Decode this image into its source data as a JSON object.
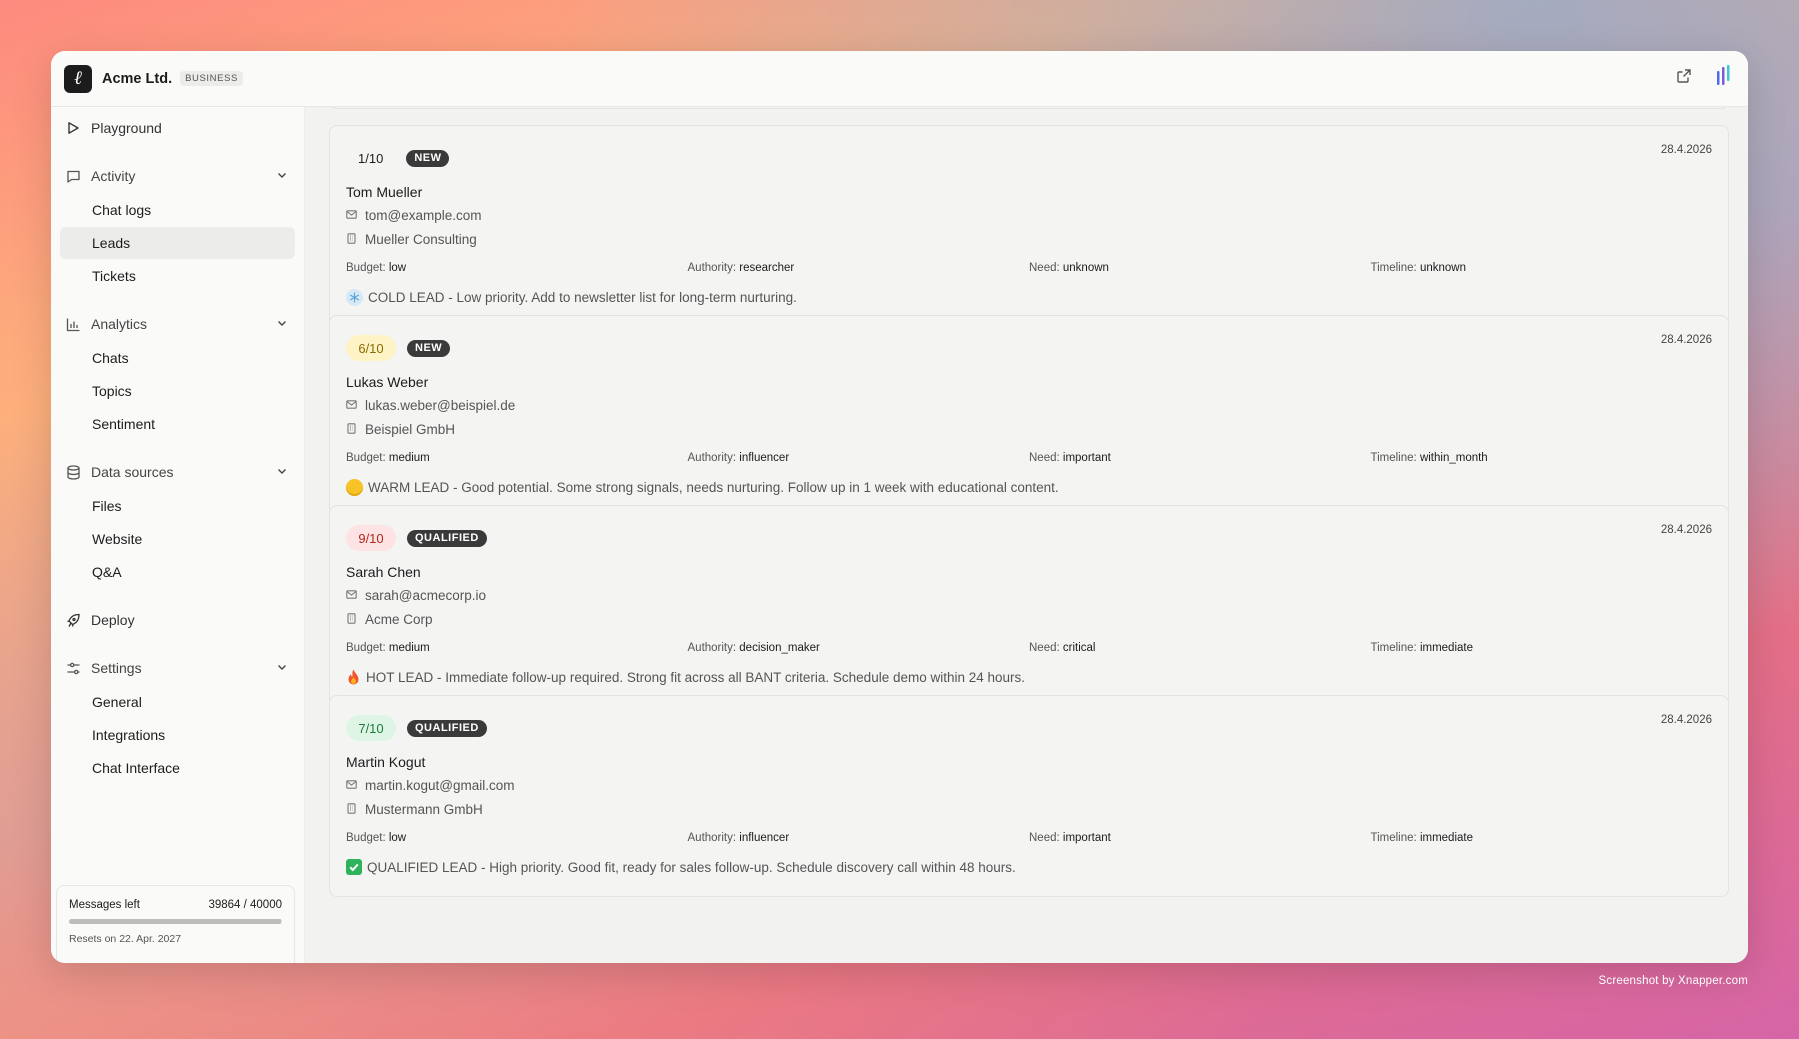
{
  "org": {
    "name": "Acme Ltd.",
    "plan": "BUSINESS",
    "logo_letter": "ℓ"
  },
  "sidebar": {
    "playground": "Playground",
    "groups": [
      {
        "label": "Activity",
        "icon": "chat-bubble-icon",
        "items": [
          "Chat logs",
          "Leads",
          "Tickets"
        ]
      },
      {
        "label": "Analytics",
        "icon": "bar-chart-icon",
        "items": [
          "Chats",
          "Topics",
          "Sentiment"
        ]
      },
      {
        "label": "Data sources",
        "icon": "database-icon",
        "items": [
          "Files",
          "Website",
          "Q&A"
        ]
      }
    ],
    "deploy": "Deploy",
    "settings": {
      "label": "Settings",
      "items": [
        "General",
        "Integrations",
        "Chat Interface"
      ]
    },
    "active_item": "Leads"
  },
  "usage": {
    "label": "Messages left",
    "value": "39864 / 40000",
    "fraction_used": 0.0034,
    "reset": "Resets on 22. Apr. 2027"
  },
  "bant_labels": {
    "budget": "Budget:",
    "authority": "Authority:",
    "need": "Need:",
    "timeline": "Timeline:"
  },
  "leads": [
    {
      "score": "1/10",
      "status": "NEW",
      "date": "28.4.2026",
      "name": "Tom Mueller",
      "email": "tom@example.com",
      "company": "Mueller Consulting",
      "budget": "low",
      "authority": "researcher",
      "need": "unknown",
      "timeline": "unknown",
      "note": "COLD LEAD - Low priority. Add to newsletter list for long-term nurturing.",
      "note_icon": "snowflake-icon"
    },
    {
      "score": "6/10",
      "status": "NEW",
      "date": "28.4.2026",
      "name": "Lukas Weber",
      "email": "lukas.weber@beispiel.de",
      "company": "Beispiel GmbH",
      "budget": "medium",
      "authority": "influencer",
      "need": "important",
      "timeline": "within_month",
      "note": "WARM LEAD - Good potential. Some strong signals, needs nurturing. Follow up in 1 week with educational content.",
      "note_icon": "yellow-circle-icon"
    },
    {
      "score": "9/10",
      "status": "QUALIFIED",
      "date": "28.4.2026",
      "name": "Sarah Chen",
      "email": "sarah@acmecorp.io",
      "company": "Acme Corp",
      "budget": "medium",
      "authority": "decision_maker",
      "need": "critical",
      "timeline": "immediate",
      "note": "HOT LEAD - Immediate follow-up required. Strong fit across all BANT criteria. Schedule demo within 24 hours.",
      "note_icon": "fire-icon"
    },
    {
      "score": "7/10",
      "status": "QUALIFIED",
      "date": "28.4.2026",
      "name": "Martin Kogut",
      "email": "martin.kogut@gmail.com",
      "company": "Mustermann GmbH",
      "budget": "low",
      "authority": "influencer",
      "need": "important",
      "timeline": "immediate",
      "note": "QUALIFIED LEAD - High priority. Good fit, ready for sales follow-up. Schedule discovery call within 48 hours.",
      "note_icon": "check-mark-icon"
    }
  ],
  "watermark": "Screenshot by Xnapper.com"
}
